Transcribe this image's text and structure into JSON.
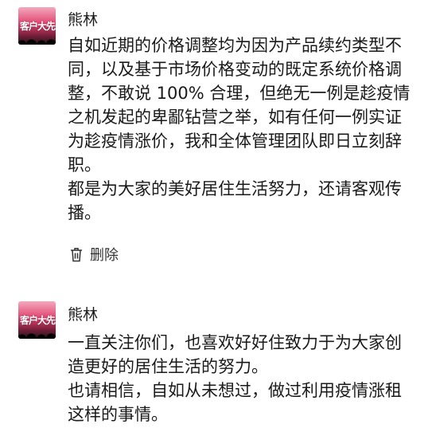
{
  "comments": [
    {
      "author": "熊林",
      "avatar_text": "客户大先",
      "paragraphs": [
        "自如近期的价格调整均为因为产品续约类型不同，以及基于市场价格变动的既定系统价格调整，不敢说 100% 合理，但绝无一例是趁疫情之机发起的卑鄙钻营之举，如有任何一例实证为趁疫情涨价，我和全体管理团队即日立刻辞职。",
        "都是为大家的美好居住生活努力，还请客观传播。"
      ],
      "action": {
        "icon": "trash-icon",
        "label": "删除"
      }
    },
    {
      "author": "熊林",
      "avatar_text": "客户大先",
      "paragraphs": [
        "一直关注你们，也喜欢好好住致力于为大家创造更好的居住生活的努力。",
        "也请相信，自如从未想过，做过利用疫情涨租这样的事情。"
      ]
    }
  ]
}
